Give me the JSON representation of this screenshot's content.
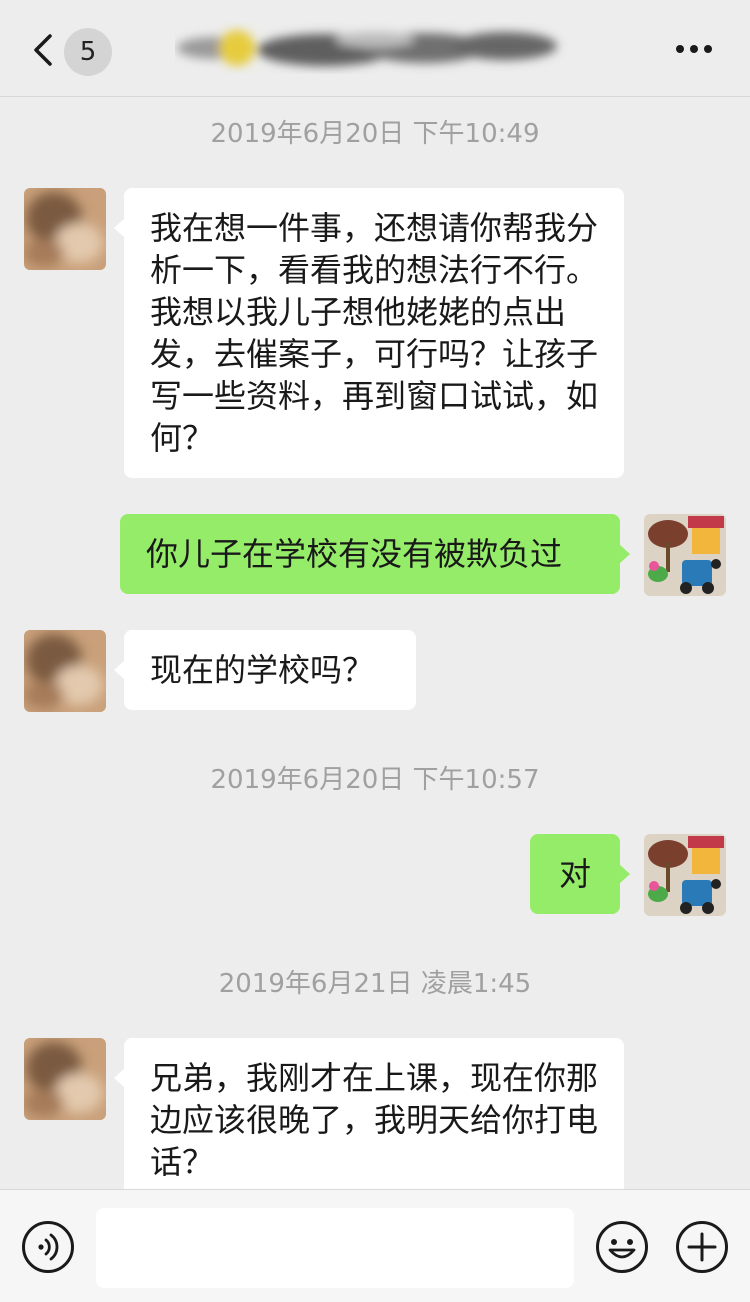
{
  "header": {
    "unread_count": "5",
    "icons": {
      "back": "chevron-left-icon",
      "more": "more-dots-icon"
    }
  },
  "messages": [
    {
      "type": "timestamp",
      "text": "2019年6月20日 下午10:49"
    },
    {
      "type": "incoming",
      "text": "我在想一件事，还想请你帮我分析一下，看看我的想法行不行。我想以我儿子想他姥姥的点出发，去催案子，可行吗？让孩子写一些资料，再到窗口试试，如何？"
    },
    {
      "type": "outgoing",
      "text": "你儿子在学校有没有被欺负过"
    },
    {
      "type": "incoming",
      "text": "现在的学校吗？"
    },
    {
      "type": "timestamp",
      "text": "2019年6月20日 下午10:57"
    },
    {
      "type": "outgoing",
      "text": "对"
    },
    {
      "type": "timestamp",
      "text": "2019年6月21日 凌晨1:45"
    },
    {
      "type": "incoming",
      "text": "兄弟，我刚才在上课，现在你那边应该很晚了，我明天给你打电话？"
    }
  ],
  "input_bar": {
    "value": "",
    "icons": {
      "voice": "voice-icon",
      "emoji": "emoji-icon",
      "add": "plus-icon"
    }
  },
  "colors": {
    "background": "#ededed",
    "incoming_bubble": "#ffffff",
    "outgoing_bubble": "#95ec69",
    "timestamp_text": "#a0a0a0"
  }
}
